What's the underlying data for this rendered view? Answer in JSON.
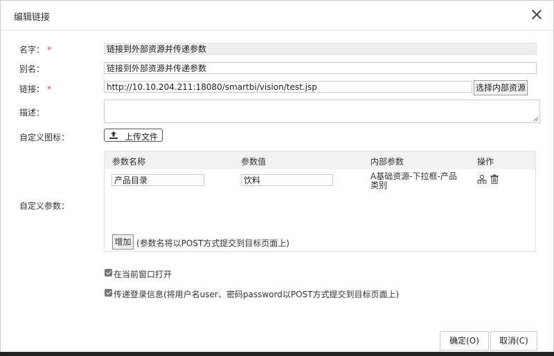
{
  "dialog": {
    "title": "编辑链接"
  },
  "form": {
    "name_label": "名字：",
    "alias_label": "别名：",
    "link_label": "链接：",
    "desc_label": "描述：",
    "icon_label": "自定义图标：",
    "params_label": "自定义参数：",
    "required_mark": "*",
    "name_value": "链接到外部资源并传递参数",
    "alias_value": "链接到外部资源并传递参数",
    "link_value": "http://10.10.204.211:18080/smartbi/vision/test.jsp",
    "select_resource_button": "选择内部资源",
    "upload_button": "上传文件",
    "desc_value": ""
  },
  "params_table": {
    "headers": [
      "参数名称",
      "参数值",
      "内部参数",
      "操作"
    ],
    "rows": [
      {
        "name": "产品目录",
        "value": "饮料",
        "inner": "A基础资源-下拉框-产品类别"
      }
    ],
    "add_button": "增加",
    "hint": "(参数名将以POST方式提交到目标页面上)"
  },
  "options": {
    "open_current_window": {
      "label": "在当前窗口打开",
      "checked": true
    },
    "pass_login": {
      "label": "传递登录信息(将用户名user、密码password以POST方式提交到目标页面上)",
      "checked": true
    }
  },
  "footer": {
    "ok": "确定(O)",
    "cancel": "取消(C)"
  },
  "icons": {
    "close": "close-icon",
    "upload": "upload-icon",
    "map": "map-param-icon",
    "delete": "trash-icon"
  }
}
